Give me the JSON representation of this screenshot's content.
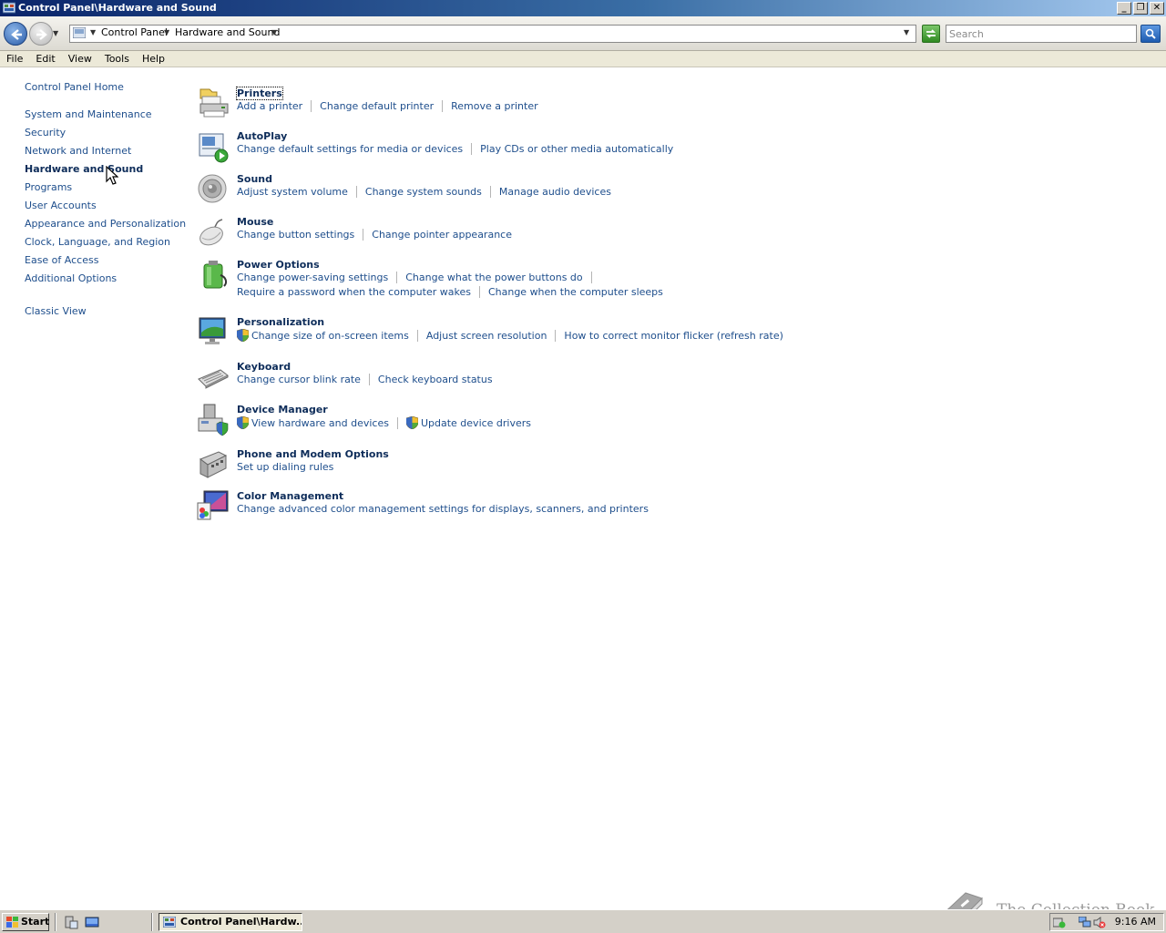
{
  "window": {
    "title": "Control Panel\\Hardware and Sound",
    "controls": [
      "minimize",
      "restore",
      "close"
    ]
  },
  "addressbar": {
    "crumbs": [
      "Control Panel",
      "Hardware and Sound"
    ],
    "search_placeholder": "Search"
  },
  "menu": [
    "File",
    "Edit",
    "View",
    "Tools",
    "Help"
  ],
  "leftnav": {
    "home": "Control Panel Home",
    "items": [
      "System and Maintenance",
      "Security",
      "Network and Internet",
      "Hardware and Sound",
      "Programs",
      "User Accounts",
      "Appearance and Personalization",
      "Clock, Language, and Region",
      "Ease of Access",
      "Additional Options"
    ],
    "current": "Hardware and Sound",
    "classic": "Classic View"
  },
  "categories": [
    {
      "icon": "printer-icon",
      "title": "Printers",
      "tasks": [
        [
          "Add a printer",
          "Change default printer",
          "Remove a printer"
        ]
      ]
    },
    {
      "icon": "autoplay-icon",
      "title": "AutoPlay",
      "tasks": [
        [
          "Change default settings for media or devices",
          "Play CDs or other media automatically"
        ]
      ]
    },
    {
      "icon": "speaker-icon",
      "title": "Sound",
      "tasks": [
        [
          "Adjust system volume",
          "Change system sounds",
          "Manage audio devices"
        ]
      ]
    },
    {
      "icon": "mouse-icon",
      "title": "Mouse",
      "tasks": [
        [
          "Change button settings",
          "Change pointer appearance"
        ]
      ]
    },
    {
      "icon": "battery-icon",
      "title": "Power Options",
      "tasks": [
        [
          "Change power-saving settings",
          "Change what the power buttons do"
        ],
        [
          "Require a password when the computer wakes",
          "Change when the computer sleeps"
        ]
      ]
    },
    {
      "icon": "monitor-icon",
      "title": "Personalization",
      "tasks": [
        [
          "Change size of on-screen items",
          "Adjust screen resolution",
          "How to correct monitor flicker (refresh rate)"
        ]
      ]
    },
    {
      "icon": "keyboard-icon",
      "title": "Keyboard",
      "tasks": [
        [
          "Change cursor blink rate",
          "Check keyboard status"
        ]
      ]
    },
    {
      "icon": "device-manager-icon",
      "title": "Device Manager",
      "tasks": [
        [
          "View hardware and devices",
          "Update device drivers"
        ]
      ]
    },
    {
      "icon": "phone-modem-icon",
      "title": "Phone and Modem Options",
      "tasks": [
        [
          "Set up dialing rules"
        ]
      ]
    },
    {
      "icon": "color-management-icon",
      "title": "Color Management",
      "tasks": [
        [
          "Change advanced color management settings for displays, scanners, and printers"
        ]
      ]
    }
  ],
  "taskbar": {
    "start": "Start",
    "window_button": "Control Panel\\Hardw...",
    "clock": "9:16 AM"
  },
  "watermark": "The Collection Book",
  "colors": {
    "link": "#1e4e8c",
    "heading": "#0e2d5a",
    "titlebar_start": "#0a246a",
    "titlebar_end": "#a6caf0"
  }
}
